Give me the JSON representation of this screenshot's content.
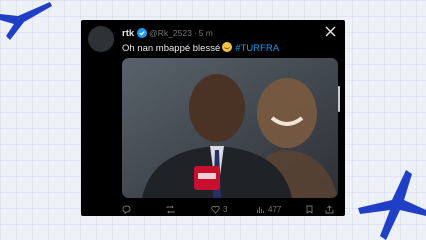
{
  "tweet": {
    "display_name": "rtk",
    "handle": "@Rk_2523",
    "separator": "·",
    "time": "5 m",
    "text": "Oh nan mbappé blessé",
    "hashtag": "#TURFRA",
    "emoji": "grimacing-face",
    "media": "photo-man-and-smiling-face"
  },
  "actions": {
    "replies": "",
    "retweets": "",
    "likes": "3",
    "views": "477"
  },
  "colors": {
    "card_bg": "#000000",
    "text": "#e7e9ea",
    "muted": "#71767b",
    "link": "#1d9bf0",
    "deco_blue": "#1f3fc6"
  }
}
